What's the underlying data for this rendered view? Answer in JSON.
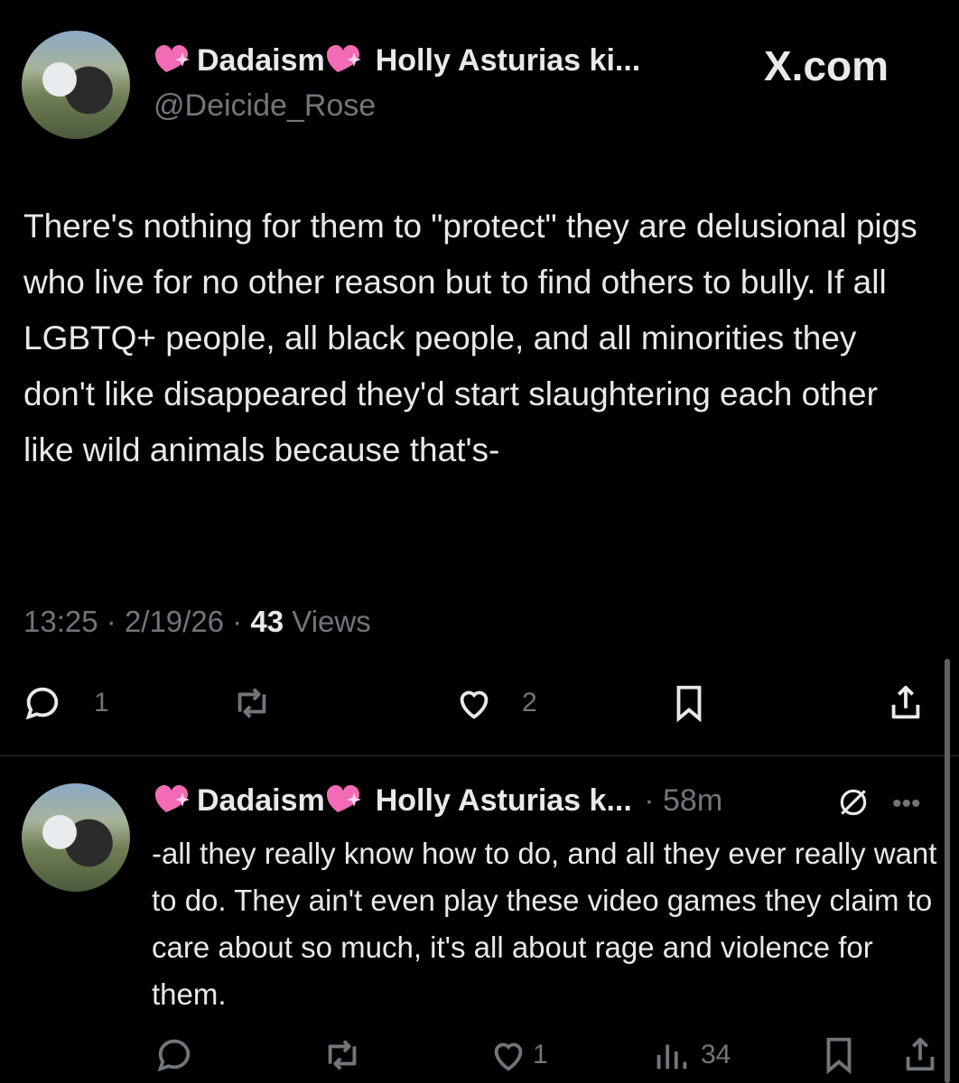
{
  "tweet": {
    "display_name_left": "Dadaism",
    "display_name_right": "Holly Asturias ki...",
    "handle": "@Deicide_Rose",
    "site_label": "X.com",
    "text": "There's nothing for them to \"protect\" they are delusional pigs who live for no other reason but to find others to bully. If all LGBTQ+ people, all black people, and all minorities they don't like disappeared they'd start slaughtering each other like wild animals because that's-",
    "time": "13:25",
    "date": "2/19/26",
    "views_count": "43",
    "views_label": "Views",
    "reply_count": "1",
    "like_count": "2"
  },
  "reply": {
    "display_name_left": "Dadaism",
    "display_name_right": "Holly Asturias k...",
    "time_ago": "58m",
    "text": "-all they really know how to do, and all they ever really want to do. They ain't even play these video games they claim to care about so much, it's all about rage and violence for them.",
    "like_count": "1",
    "views_count": "34"
  },
  "colors": {
    "background": "#000000",
    "text": "#e7e9ea",
    "muted": "#71767b",
    "heart": "#f36bb4"
  }
}
